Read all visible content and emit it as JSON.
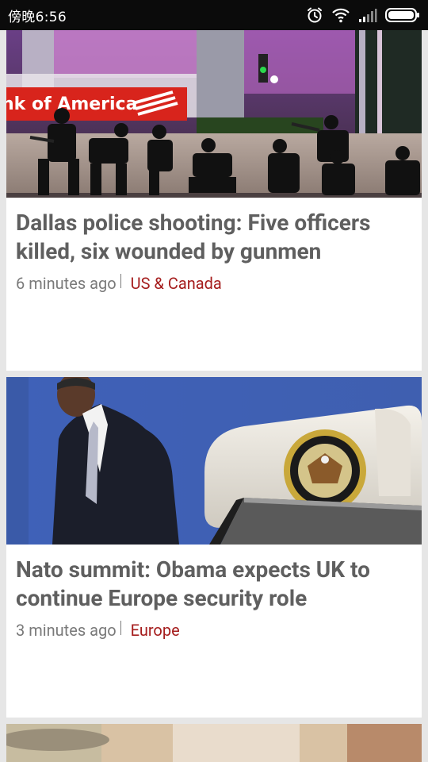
{
  "status_bar": {
    "time": "傍晚6:56",
    "icons": [
      "alarm-icon",
      "wifi-icon",
      "signal-icon",
      "battery-icon"
    ]
  },
  "feed": {
    "articles": [
      {
        "title": "Dallas police shooting: Five officers killed, six wounded by gunmen",
        "time": "6 minutes ago",
        "section": "US & Canada",
        "image_sign_text": "nk of America"
      },
      {
        "title": "Nato summit: Obama expects UK to continue Europe security role",
        "time": "3 minutes ago",
        "section": "Europe"
      }
    ]
  },
  "colors": {
    "section_link": "#a51d1d",
    "title_text": "#5f5f5f",
    "background": "#e6e6e6"
  }
}
